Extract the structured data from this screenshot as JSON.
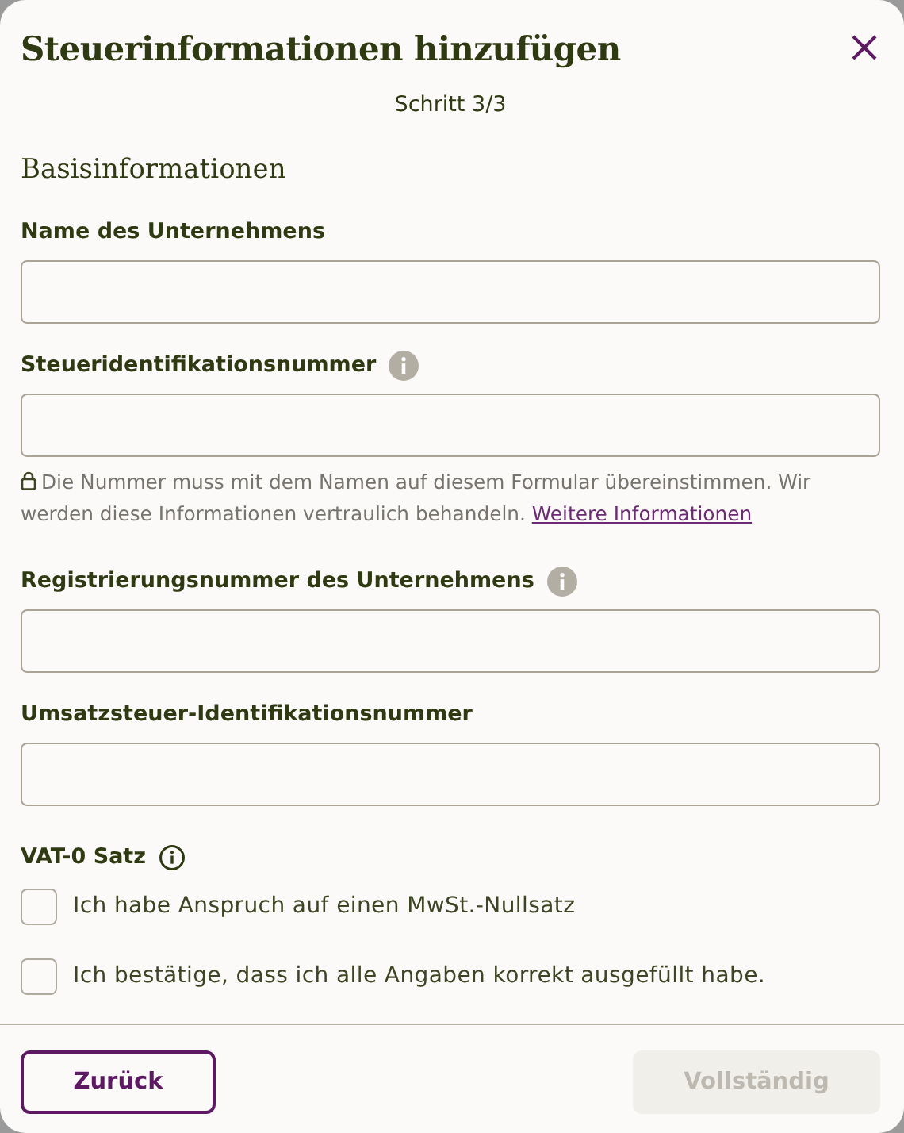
{
  "dialog": {
    "title": "Steuerinformationen hinzufügen",
    "step": "Schritt 3/3",
    "section": "Basisinformationen"
  },
  "fields": [
    {
      "label": "Name des Unternehmens",
      "info": false
    },
    {
      "label": "Steueridentifikationsnummer",
      "info": true,
      "hint": "Die Nummer muss mit dem Namen auf diesem Formular übereinstimmen. Wir werden diese Informationen vertraulich behandeln.",
      "hint_link": "Weitere Informationen"
    },
    {
      "label": "Registrierungsnummer des Unternehmens",
      "info": true
    },
    {
      "label": "Umsatzsteuer-Identifikationsnummer",
      "info": false
    }
  ],
  "vat": {
    "label": "VAT-0 Satz"
  },
  "checkboxes": [
    {
      "label": "Ich habe Anspruch auf einen MwSt.-Nullsatz",
      "checked": false
    },
    {
      "label": "Ich bestätige, dass ich alle Angaben korrekt ausgefüllt habe.",
      "checked": false
    }
  ],
  "buttons": {
    "back": {
      "label": "Zurück",
      "disabled": false
    },
    "complete": {
      "label": "Vollständig",
      "disabled": true
    }
  }
}
